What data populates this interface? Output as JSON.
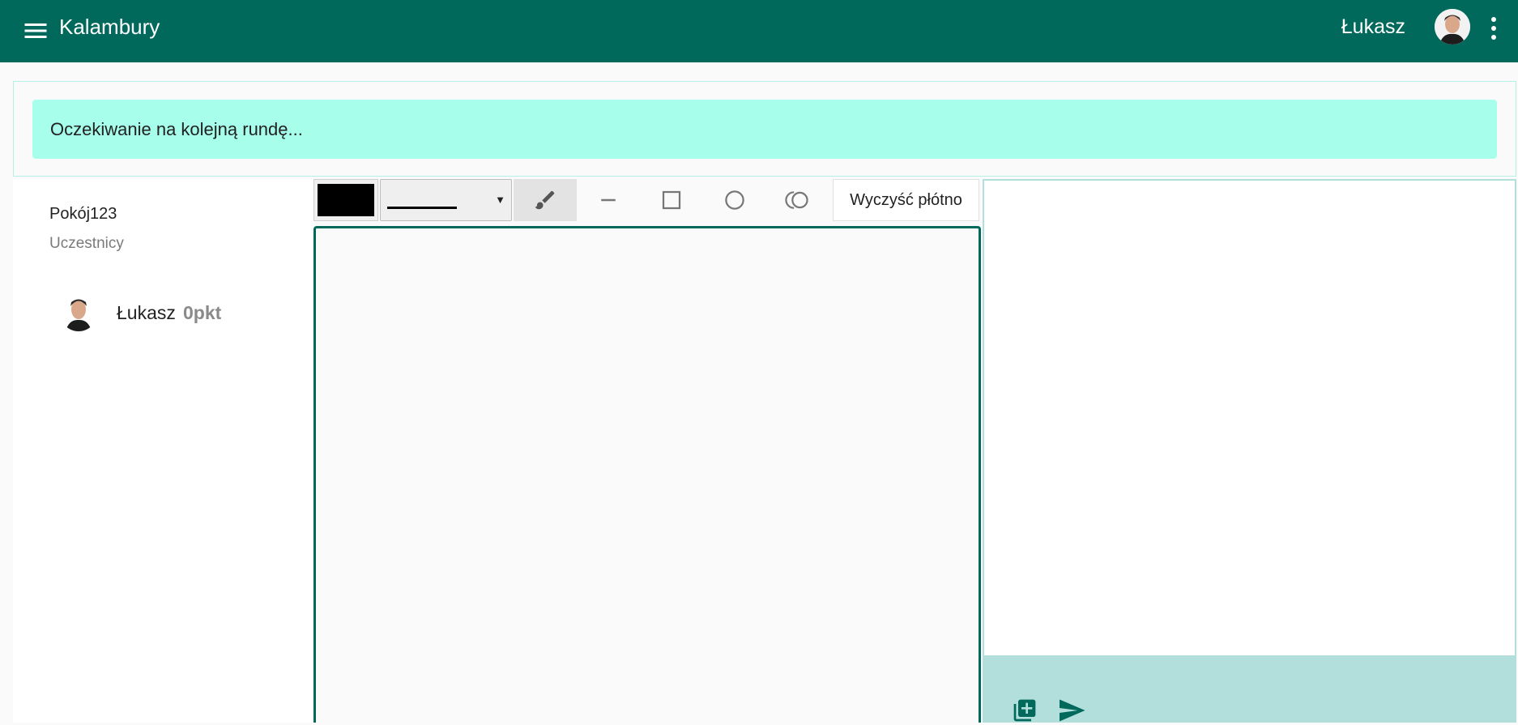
{
  "app": {
    "title": "Kalambury"
  },
  "user": {
    "name": "Łukasz"
  },
  "status": {
    "message": "Oczekiwanie na kolejną rundę..."
  },
  "room": {
    "name": "Pokój123",
    "participants_label": "Uczestnicy",
    "participants": [
      {
        "name": "Łukasz",
        "points": "0pkt"
      }
    ]
  },
  "toolbar": {
    "color": "#000000",
    "width_arrow": "▼",
    "active_tool": "brush",
    "clear_label": "Wyczyść płótno"
  },
  "colors": {
    "primary": "#00695c",
    "status_bg": "#a7ffeb",
    "chat_footer": "#b2dfdb"
  },
  "icons": [
    "menu-icon",
    "more-vert-icon",
    "brush-icon",
    "line-icon",
    "rectangle-icon",
    "circle-icon",
    "eraser-icon",
    "add-image-icon",
    "send-icon"
  ]
}
